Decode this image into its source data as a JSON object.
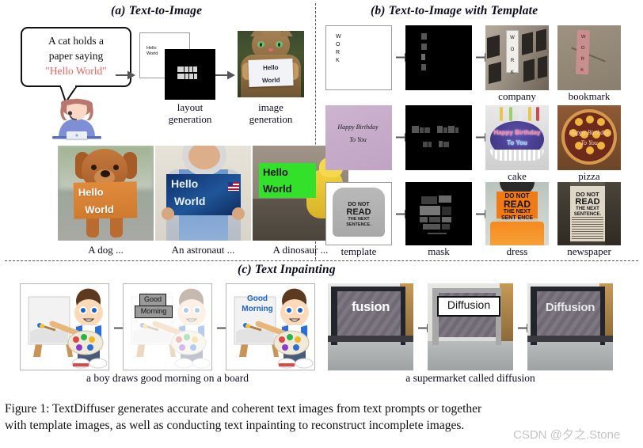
{
  "figure": {
    "caption_line1": "Figure 1:  TextDiffuser generates accurate and coherent text images from text prompts or together",
    "caption_line2": "with template images, as well as conducting text inpainting to reconstruct incomplete images.",
    "watermark": "CSDN @夕之.Stone"
  },
  "sections": {
    "a": {
      "title": "(a) Text-to-Image"
    },
    "b": {
      "title": "(b) Text-to-Image with Template"
    },
    "c": {
      "title": "(c) Text Inpainting"
    }
  },
  "panel_a": {
    "prompt": {
      "line1": "A cat holds a",
      "line2": "paper saying",
      "line3_quoted": "\"Hello World\"",
      "highlight_color": "#f0605e"
    },
    "layout_stage": {
      "label_line1": "layout",
      "label_line2": "generation",
      "mini_text_line1": "Hello",
      "mini_text_line2": "World"
    },
    "image_stage": {
      "label_line1": "image",
      "label_line2": "generation",
      "sign_line1": "Hello",
      "sign_line2": "World"
    },
    "examples": [
      {
        "caption": "A dog ...",
        "sign_line1": "Hello",
        "sign_line2": "World"
      },
      {
        "caption": "An astronaut ...",
        "sign_line1": "Hello",
        "sign_line2": "World"
      },
      {
        "caption": "A dinosaur ...",
        "sign_line1": "Hello",
        "sign_line2": "World"
      }
    ]
  },
  "panel_b": {
    "column_labels": [
      "template",
      "mask",
      "dress",
      "newspaper"
    ],
    "rows": [
      {
        "template_text": "W\nO\nR\nK",
        "template_letters": [
          "W",
          "O",
          "R",
          "K"
        ],
        "result_left": {
          "caption": "company",
          "overlay_letters": [
            "W",
            "O",
            "R",
            "K"
          ]
        },
        "result_right": {
          "caption": "bookmark",
          "overlay_letters": [
            "W",
            "O",
            "R",
            "K"
          ]
        }
      },
      {
        "template_line1": "Happy  Birthday",
        "template_line2": "To  You",
        "result_left": {
          "caption": "cake",
          "overlay_line1": "Happy  Birthday",
          "overlay_line2": "To You"
        },
        "result_right": {
          "caption": "pizza",
          "overlay_line1": "Happy  Birthday",
          "overlay_line2": "To  You"
        }
      },
      {
        "template_line1": "DO NOT",
        "template_line2": "READ",
        "template_line3": "THE NEXT",
        "template_line4": "SENTENCE.",
        "result_left": {
          "caption": "dress",
          "overlay_line1": "DO NOT",
          "overlay_line2": "READ",
          "overlay_line3": "THE NEXT",
          "overlay_line4": "SENT ENCE"
        },
        "result_right": {
          "caption": "newspaper",
          "overlay_line1": "DO NOT",
          "overlay_line2": "READ",
          "overlay_line3": "THE NEXT",
          "overlay_line4": "SENTENCE."
        }
      }
    ]
  },
  "panel_c": {
    "left": {
      "caption": "a boy draws good morning on a board",
      "mask_line1": "Good",
      "mask_line2": "Morning",
      "result_line1": "Good",
      "result_line2": "Morning"
    },
    "right": {
      "caption": "a supermarket called diffusion",
      "original_text": "fusion",
      "mask_text": "Diffusion",
      "result_text": "Diffusion"
    }
  }
}
